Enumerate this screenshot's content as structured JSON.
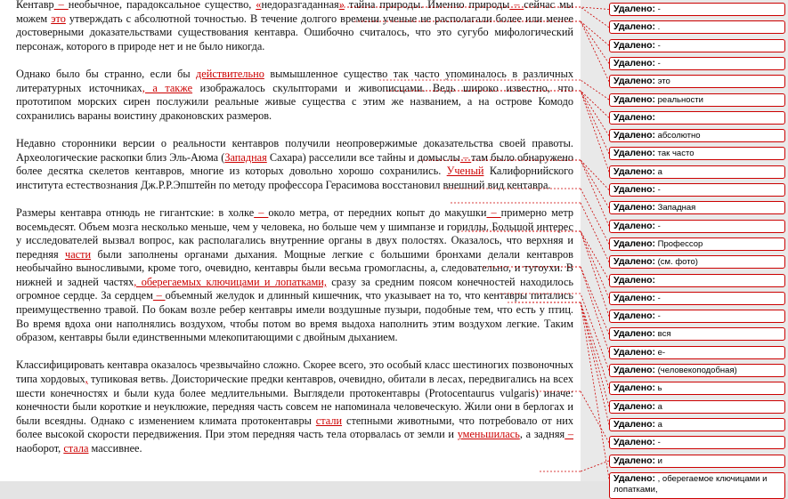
{
  "paragraphs": [
    [
      {
        "t": "Кентавр"
      },
      {
        "t": " – ",
        "ins": true
      },
      {
        "t": "необычное, парадоксальное существо, "
      },
      {
        "t": "«",
        "ins": true
      },
      {
        "t": "недоразгаданная"
      },
      {
        "t": "»",
        "ins": true
      },
      {
        "t": " тайна природы. Именно природы"
      },
      {
        "t": " – ",
        "ins": true
      },
      {
        "t": "сейчас мы можем "
      },
      {
        "t": "это",
        "ins": true
      },
      {
        "t": " утверждать с абсолютной точностью. В течение долгого времени ученые не располагали более или менее достоверными доказательствами существования кентавра. Ошибочно считалось, что это сугубо мифологический  персонаж, которого в природе нет и не было никогда."
      }
    ],
    [
      {
        "t": "Однако было бы странно, если бы "
      },
      {
        "t": "действительно",
        "ins": true
      },
      {
        "t": " вымышленное существо так часто упоминалось в различных литературных источниках"
      },
      {
        "t": ", а также",
        "ins": true
      },
      {
        "t": " изображалось скульпторами и живописцами. Ведь широко известно, что прототипом морских сирен послужили реальные живые существа с этим же названием, а на острове Комодо сохранились вараны воистину драконовских размеров."
      }
    ],
    [
      {
        "t": "Недавно сторонники версии о реальности кентавров получили неопровержимые доказательства своей правоты. Археологические раскопки близ Эль-Аюма ("
      },
      {
        "t": "Западная",
        "ins": true
      },
      {
        "t": " Сахара) расселили все тайны и домыслы"
      },
      {
        "t": " – ",
        "ins": true
      },
      {
        "t": "там было обнаружено более десятка скелетов кентавров, многие из которых довольно хорошо сохранились. "
      },
      {
        "t": "Ученый",
        "ins": true
      },
      {
        "t": " Калифорнийского института естествознания Дж.Р.Р.Эпштейн по методу профессора Герасимова восстановил внешний вид кентавра."
      }
    ],
    [
      {
        "t": "Размеры кентавра отнюдь не гигантские: в холке"
      },
      {
        "t": " – ",
        "ins": true
      },
      {
        "t": "около метра, от передних копыт до макушки"
      },
      {
        "t": " – ",
        "ins": true
      },
      {
        "t": "примерно метр восемьдесят. Объем мозга несколько меньше, чем у человека, но больше чем у шимпанзе и гориллы. Большой интерес у исследователей вызвал вопрос, как располагались внутренние органы в двух полостях. Оказалось, что верхняя и передняя "
      },
      {
        "t": "части",
        "ins": true
      },
      {
        "t": " были заполнены органами дыхания. Мощные легкие с большими бронхами делали кентавров необычайно выносливыми, кроме того, очевидно, кентавры были весьма громогласны, а, следовательно, и тугоухи. В нижней и задней частях"
      },
      {
        "t": ", оберегаемых ключицами и лопатками,",
        "ins": true
      },
      {
        "t": " сразу за средним поясом конечностей находилось огромное сердце. За сердцем"
      },
      {
        "t": " – ",
        "ins": true
      },
      {
        "t": "объемный желудок и длинный кишечник, что указывает на то, что кентавры питались преимущественно травой. По бокам возле ребер кентавры имели воздушные пузыри, подобные тем, что есть у птиц. Во время вдоха они наполнялись воздухом, чтобы потом во время выдоха наполнить этим воздухом легкие. Таким образом, кентавры были единственными млекопитающими с двойным дыханием."
      }
    ],
    [
      {
        "t": "Классифицировать кентавра оказалось чрезвычайно сложно. Скорее всего, это особый класс шестиногих позвоночных типа хордовых"
      },
      {
        "t": ",",
        "ins": true
      },
      {
        "t": " тупиковая ветвь. Доисторические предки кентавров, очевидно, обитали в лесах, передвигались на всех шести конечностях и были куда более медлительными. Выглядели протокентавры (Protocentaurus vulgaris) иначе: конечности были короткие и неуклюжие, передняя часть совсем не напоминала человеческую. Жили они в берлогах и были всеядны. Однако с изменением климата протокентавры "
      },
      {
        "t": "стали",
        "ins": true
      },
      {
        "t": " степными животными, что потребовало от них более высокой скорости передвижения. При этом передняя часть тела оторвалась от земли и "
      },
      {
        "t": "уменьшилась",
        "ins": true
      },
      {
        "t": ", а задняя"
      },
      {
        "t": " – ",
        "ins": true
      },
      {
        "t": "наоборот, "
      },
      {
        "t": "стала",
        "ins": true
      },
      {
        "t": " массивнее."
      }
    ]
  ],
  "balloons": [
    {
      "label": "Удалено:",
      "text": "-"
    },
    {
      "label": "Удалено:",
      "text": "."
    },
    {
      "label": "Удалено:",
      "text": "-"
    },
    {
      "label": "Удалено:",
      "text": "-"
    },
    {
      "label": "Удалено:",
      "text": "это"
    },
    {
      "label": "Удалено:",
      "text": "реальности"
    },
    {
      "label": "Удалено:",
      "text": ""
    },
    {
      "label": "Удалено:",
      "text": "абсолютно"
    },
    {
      "label": "Удалено:",
      "text": "так часто"
    },
    {
      "label": "Удалено:",
      "text": "а"
    },
    {
      "label": "Удалено:",
      "text": "-"
    },
    {
      "label": "Удалено:",
      "text": " Западная"
    },
    {
      "label": "Удалено:",
      "text": "-"
    },
    {
      "label": "Удалено:",
      "text": "Профессор"
    },
    {
      "label": "Удалено:",
      "text": " (см. фото)"
    },
    {
      "label": "Удалено:",
      "text": ""
    },
    {
      "label": "Удалено:",
      "text": "-"
    },
    {
      "label": "Удалено:",
      "text": "-"
    },
    {
      "label": "Удалено:",
      "text": "вся"
    },
    {
      "label": "Удалено:",
      "text": "е-"
    },
    {
      "label": "Удалено:",
      "text": " (человекоподобная)"
    },
    {
      "label": "Удалено:",
      "text": "ь"
    },
    {
      "label": "Удалено:",
      "text": "а"
    },
    {
      "label": "Удалено:",
      "text": "а"
    },
    {
      "label": "Удалено:",
      "text": "-"
    },
    {
      "label": "Удалено:",
      "text": "и"
    },
    {
      "label": "Удалено:",
      "text": ", оберегаемое ключицами и лопатками,"
    }
  ]
}
